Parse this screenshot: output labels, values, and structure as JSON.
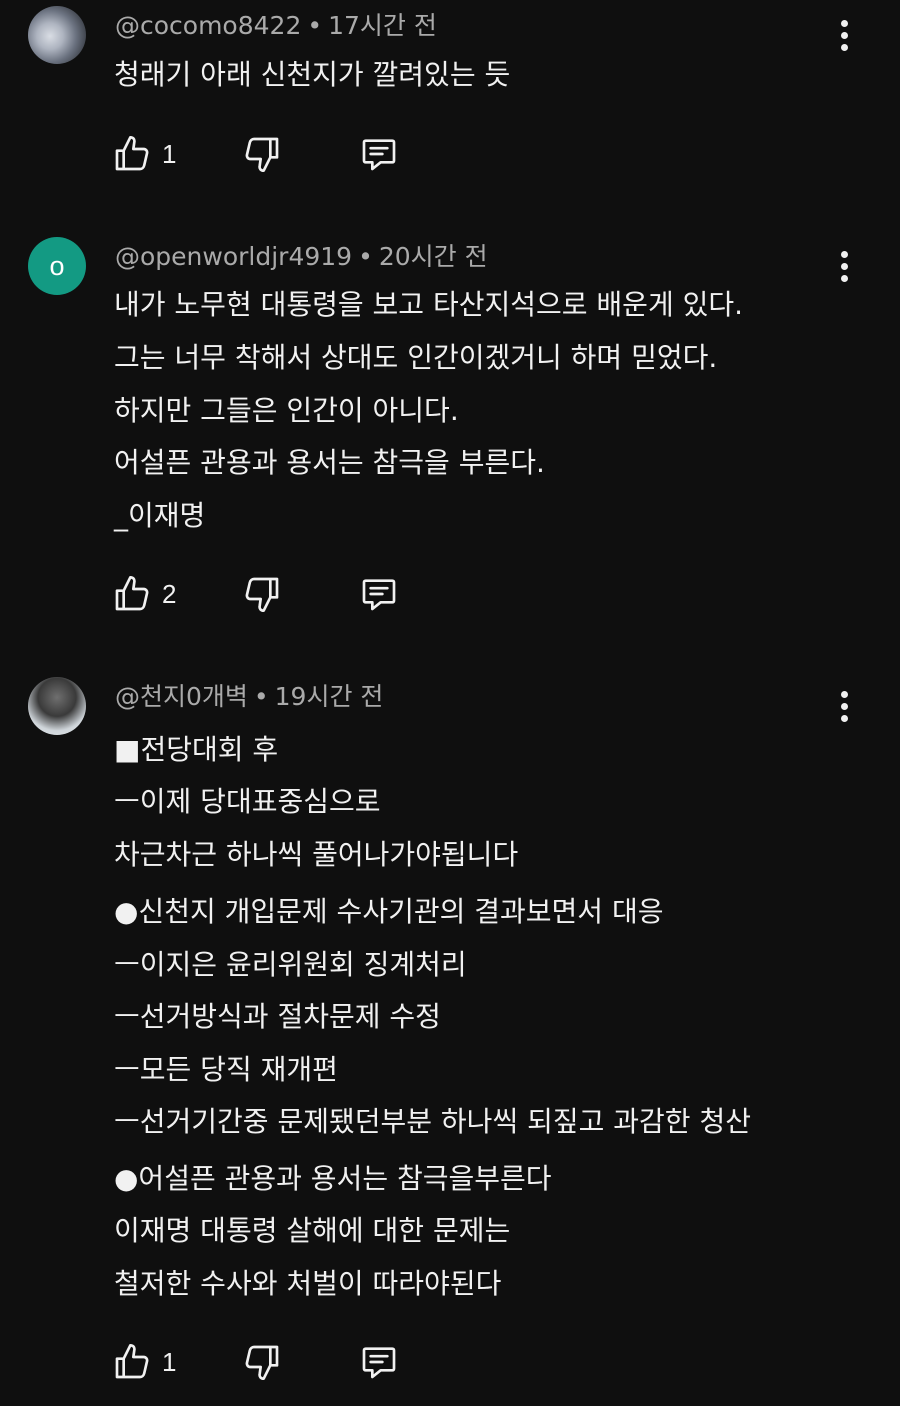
{
  "comments": [
    {
      "author": "@cocomo8422",
      "time": "17시간 전",
      "avatar_letter": "",
      "lines": [
        "청래기 아래 신천지가 깔려있는 듯"
      ],
      "likes": "1"
    },
    {
      "author": "@openworldjr4919",
      "time": "20시간 전",
      "avatar_letter": "o",
      "lines": [
        "내가 노무현 대통령을 보고 타산지석으로 배운게 있다.",
        "그는 너무 착해서 상대도 인간이겠거니 하며 믿었다.",
        "하지만 그들은 인간이 아니다.",
        "어설픈 관용과 용서는 참극을 부른다.",
        "_이재명"
      ],
      "likes": "2"
    },
    {
      "author": "@천지0개벽",
      "time": "19시간 전",
      "avatar_letter": "",
      "lines": [
        "■전당대회 후",
        "ㅡ이제 당대표중심으로",
        "차근차근 하나씩 풀어나가야됩니다",
        "●신천지 개입문제 수사기관의 결과보면서 대응",
        "ㅡ이지은 윤리위원회 징계처리",
        "ㅡ선거방식과 절차문제 수정",
        "ㅡ모든 당직 재개편",
        "ㅡ선거기간중 문제됐던부분 하나씩 되짚고 과감한 청산",
        "●어설픈 관용과 용서는 참극을부른다",
        "이재명 대통령 살해에 대한 문제는",
        "철저한 수사와 처벌이 따라야된다"
      ],
      "likes": "1"
    }
  ],
  "separator": "•",
  "icons": {
    "like": "thumbs-up-icon",
    "dislike": "thumbs-down-icon",
    "reply": "reply-icon",
    "more": "more-vertical-icon"
  }
}
